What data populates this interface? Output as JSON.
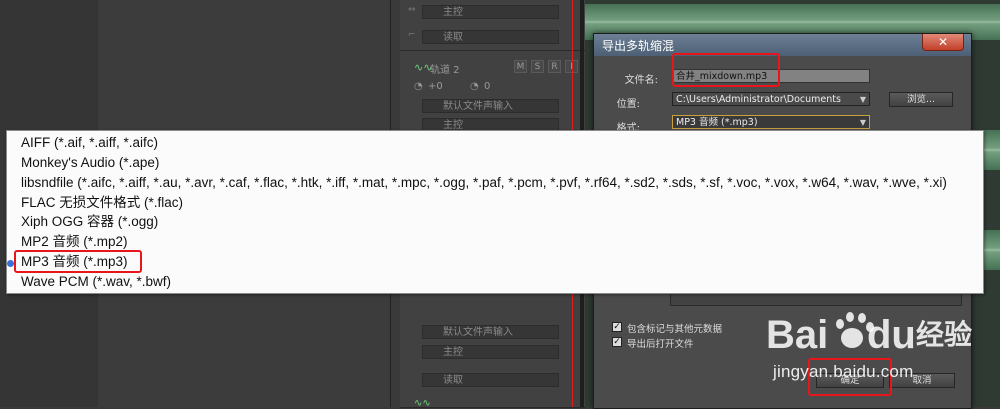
{
  "tracks": {
    "read_label": "读取",
    "master_label": "主控",
    "track2_label": "轨道 2",
    "input_label": "默认文件声输入",
    "volume_value": "+0",
    "pan_value": "0",
    "m": "M",
    "s": "S",
    "r": "R",
    "i": "I"
  },
  "dialog": {
    "title": "导出多轨缩混",
    "close_symbol": "✕",
    "filename_label": "文件名:",
    "filename_value": "合井_mixdown.mp3",
    "location_label": "位置:",
    "location_value": "C:\\Users\\Administrator\\Documents",
    "browse_label": "浏览...",
    "format_label": "格式:",
    "format_value": "MP3 音频 (*.mp3)",
    "checkbox_metadata": "包含标记与其他元数据",
    "checkbox_open": "导出后打开文件",
    "ok_label": "确定",
    "cancel_label": "取消"
  },
  "format_options": [
    "AIFF (*.aif, *.aiff, *.aifc)",
    "Monkey's Audio (*.ape)",
    "libsndfile (*.aifc, *.aiff, *.au, *.avr, *.caf, *.flac, *.htk, *.iff, *.mat, *.mpc, *.ogg, *.paf, *.pcm, *.pvf, *.rf64, *.sd2, *.sds, *.sf, *.voc, *.vox, *.w64, *.wav, *.wve, *.xi)",
    "FLAC 无损文件格式 (*.flac)",
    "Xiph OGG 容器 (*.ogg)",
    "MP2 音频 (*.mp2)",
    "MP3 音频 (*.mp3)",
    "Wave PCM (*.wav, *.bwf)"
  ],
  "selected_option_index": 6,
  "watermark": {
    "brand": "Bai",
    "brand2": "du",
    "jingyan": "经验",
    "url": "jingyan.baidu.com"
  },
  "colors": {
    "highlight_red": "#e8161a",
    "selected_dot": "#3a6fd8",
    "titlebar": "#5a6d84"
  }
}
